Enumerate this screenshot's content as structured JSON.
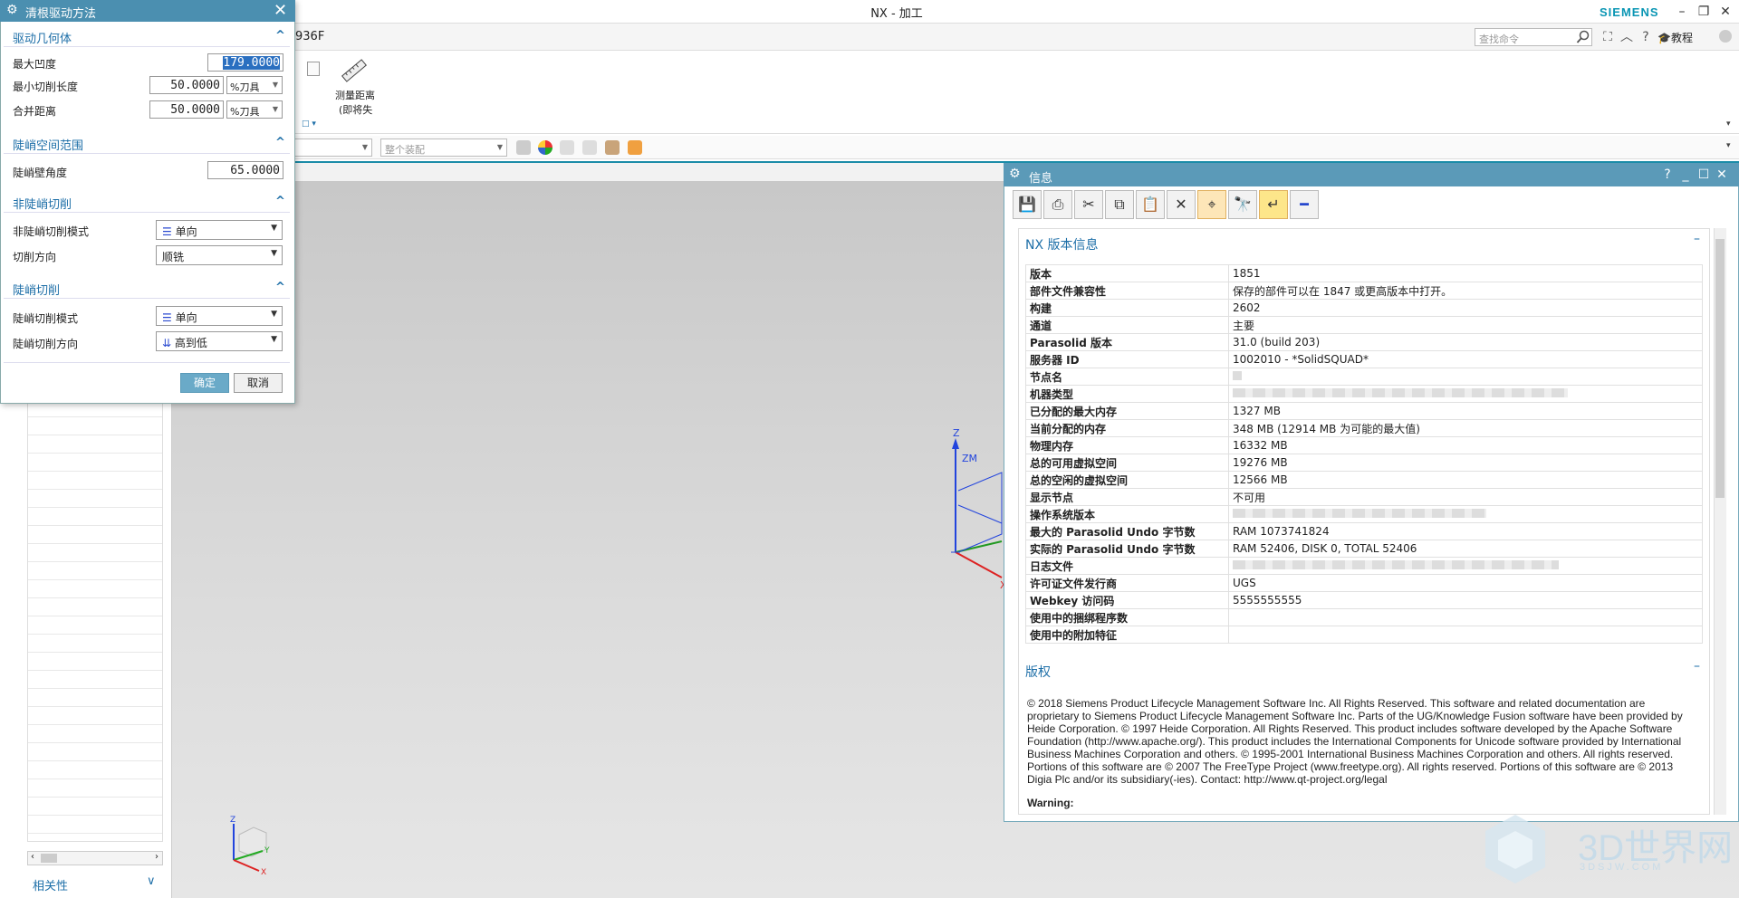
{
  "window": {
    "title": "NX - 加工",
    "brand": "SIEMENS",
    "part_name": "936F",
    "minimize": "–",
    "restore": "❐",
    "close": "✕"
  },
  "command_finder": {
    "placeholder": "查找命令",
    "tutorial_label": "教程"
  },
  "ribbon": {
    "measure_label_line1": "测量距离",
    "measure_label_line2": "(即将失"
  },
  "selection_bar": {
    "assembly_scope": "整个装配"
  },
  "navigator": {
    "relevance_label": "相关性"
  },
  "dialog": {
    "title": "清根驱动方法",
    "sections": {
      "drive_geometry": "驱动几何体",
      "steep_range": "陡峭空间范围",
      "nonsteep_cut": "非陡峭切削",
      "steep_cut": "陡峭切削"
    },
    "fields": {
      "max_concavity_label": "最大凹度",
      "max_concavity_value": "179.0000",
      "min_cut_length_label": "最小切削长度",
      "min_cut_length_value": "50.0000",
      "min_cut_length_unit": "%刀具",
      "merge_distance_label": "合并距离",
      "merge_distance_value": "50.0000",
      "merge_distance_unit": "%刀具",
      "steep_angle_label": "陡峭壁角度",
      "steep_angle_value": "65.0000",
      "nonsteep_pattern_label": "非陡峭切削模式",
      "nonsteep_pattern_value": "单向",
      "cut_direction_label": "切削方向",
      "cut_direction_value": "顺铣",
      "steep_pattern_label": "陡峭切削模式",
      "steep_pattern_value": "单向",
      "steep_direction_label": "陡峭切削方向",
      "steep_direction_value": "高到低"
    },
    "ok": "确定",
    "cancel": "取消"
  },
  "wcs": {
    "z_label": "Z",
    "zm_label": "ZM",
    "x_label": "X"
  },
  "view_triad": {
    "z": "Z",
    "y": "Y",
    "x": "X"
  },
  "info_window": {
    "title": "信息",
    "help": "?",
    "nx_version_title": "NX 版本信息",
    "rows": [
      {
        "key": "版本",
        "value": "1851"
      },
      {
        "key": "部件文件兼容性",
        "value": "保存的部件可以在 1847 或更高版本中打开。"
      },
      {
        "key": "构建",
        "value": "2602"
      },
      {
        "key": "通道",
        "value": "主要"
      },
      {
        "key": "Parasolid 版本",
        "value": "31.0 (build 203)"
      },
      {
        "key": "服务器 ID",
        "value": "1002010 - *SolidSQUAD*"
      },
      {
        "key": "节点名",
        "value": ""
      },
      {
        "key": "机器类型",
        "value": ""
      },
      {
        "key": "已分配的最大内存",
        "value": "1327 MB"
      },
      {
        "key": "当前分配的内存",
        "value": "348 MB (12914 MB 为可能的最大值)"
      },
      {
        "key": "物理内存",
        "value": "16332 MB"
      },
      {
        "key": "总的可用虚拟空间",
        "value": "19276 MB"
      },
      {
        "key": "总的空闲的虚拟空间",
        "value": "12566 MB"
      },
      {
        "key": "显示节点",
        "value": "不可用"
      },
      {
        "key": "操作系统版本",
        "value": ""
      },
      {
        "key": "最大的 Parasolid Undo 字节数",
        "value": "RAM 1073741824"
      },
      {
        "key": "实际的 Parasolid Undo 字节数",
        "value": "RAM 52406, DISK 0, TOTAL 52406"
      },
      {
        "key": "日志文件",
        "value": ""
      },
      {
        "key": "许可证文件发行商",
        "value": "UGS"
      },
      {
        "key": "Webkey 访问码",
        "value": "5555555555"
      },
      {
        "key": "使用中的捆绑程序数",
        "value": ""
      },
      {
        "key": "使用中的附加特征",
        "value": ""
      }
    ],
    "copyright_title": "版权",
    "copyright_text": "© 2018 Siemens Product Lifecycle Management Software Inc. All Rights Reserved. This software and related documentation are proprietary to Siemens Product Lifecycle Management Software Inc. Parts of the UG/Knowledge Fusion software have been provided by Heide Corporation. © 1997 Heide Corporation. All Rights Reserved. This product includes software developed by the Apache Software Foundation (http://www.apache.org/). This product includes the International Components for Unicode software provided by International Business Machines Corporation and others. © 1995-2001 International Business Machines Corporation and others. All rights reserved. Portions of this software are © 2007 The FreeType Project (www.freetype.org). All rights reserved. Portions of this software are © 2013 Digia Plc and/or its subsidiary(-ies). Contact: http://www.qt-project.org/legal",
    "warning_label": "Warning:"
  },
  "watermark": {
    "text": "3D世界网",
    "url": "3DSJW.COM"
  }
}
